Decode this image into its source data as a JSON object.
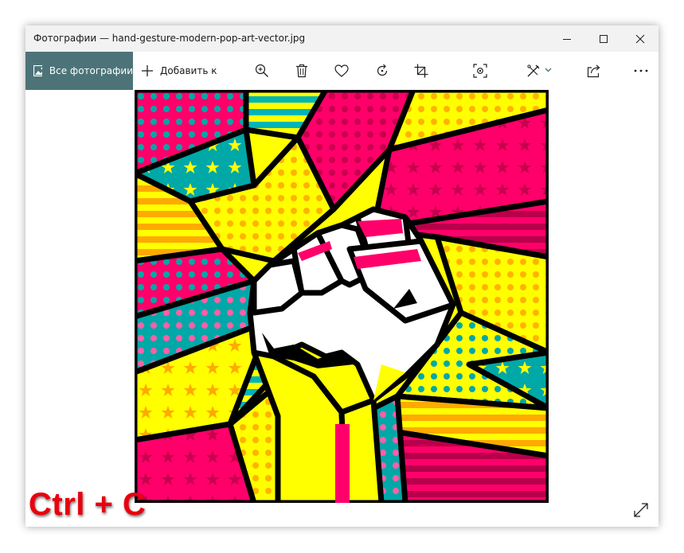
{
  "window": {
    "title": "Фотографии — hand-gesture-modern-pop-art-vector.jpg"
  },
  "toolbar": {
    "all_photos_label": "Все фотографии",
    "add_to_label": "Добавить к",
    "buttons": [
      "zoom-in-icon",
      "delete-icon",
      "favorite-icon",
      "rotate-icon",
      "crop-icon",
      "enhance-icon",
      "edit-icon",
      "share-icon",
      "more-icon"
    ]
  },
  "overlay": {
    "hotkey_text": "Ctrl + C"
  },
  "colors": {
    "accent": "#4c7478",
    "pop_pink": "#ff006a",
    "pop_yellow": "#ffff00",
    "pop_teal": "#00a8a8",
    "pop_orange": "#ffaa00",
    "hotkey_red": "#e8000e"
  }
}
